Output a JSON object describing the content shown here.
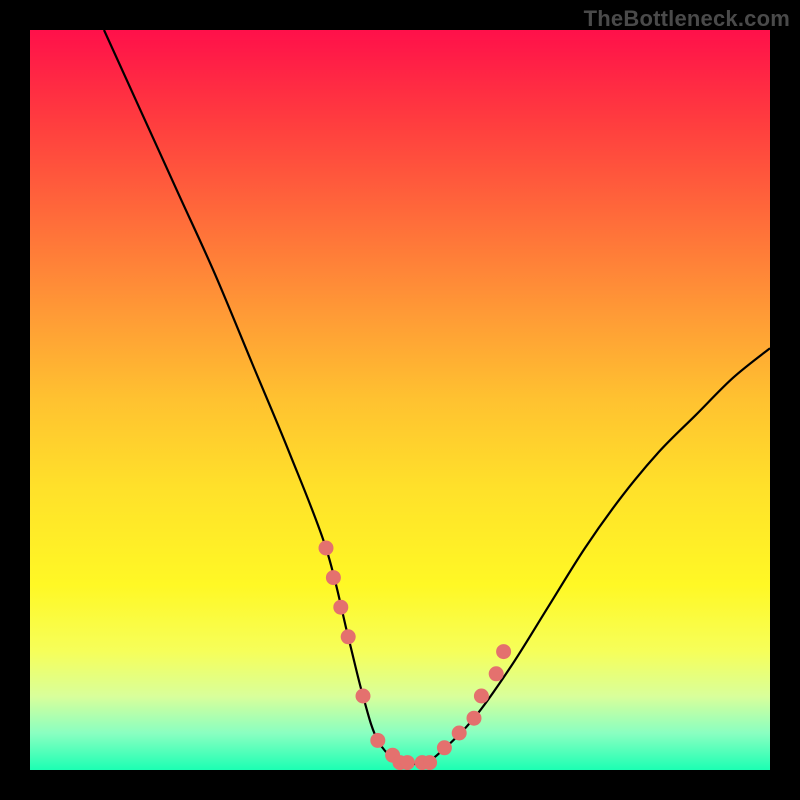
{
  "watermark": "TheBottleneck.com",
  "chart_data": {
    "type": "line",
    "title": "",
    "xlabel": "",
    "ylabel": "",
    "xlim": [
      0,
      100
    ],
    "ylim": [
      0,
      100
    ],
    "series": [
      {
        "name": "curve",
        "x": [
          10,
          15,
          20,
          25,
          30,
          35,
          40,
          43,
          45,
          47,
          50,
          53,
          55,
          60,
          65,
          70,
          75,
          80,
          85,
          90,
          95,
          100
        ],
        "y": [
          100,
          89,
          78,
          67,
          55,
          43,
          30,
          18,
          10,
          4,
          1,
          1,
          2,
          7,
          14,
          22,
          30,
          37,
          43,
          48,
          53,
          57
        ]
      }
    ],
    "markers": {
      "name": "dots",
      "x": [
        40,
        41,
        42,
        43,
        45,
        47,
        49,
        50,
        51,
        53,
        54,
        56,
        58,
        60,
        61,
        63,
        64
      ],
      "y": [
        30,
        26,
        22,
        18,
        10,
        4,
        2,
        1,
        1,
        1,
        1,
        3,
        5,
        7,
        10,
        13,
        16
      ]
    },
    "colors": {
      "line": "#000000",
      "marker_fill": "#e4716e",
      "marker_stroke": "#e4716e"
    }
  }
}
